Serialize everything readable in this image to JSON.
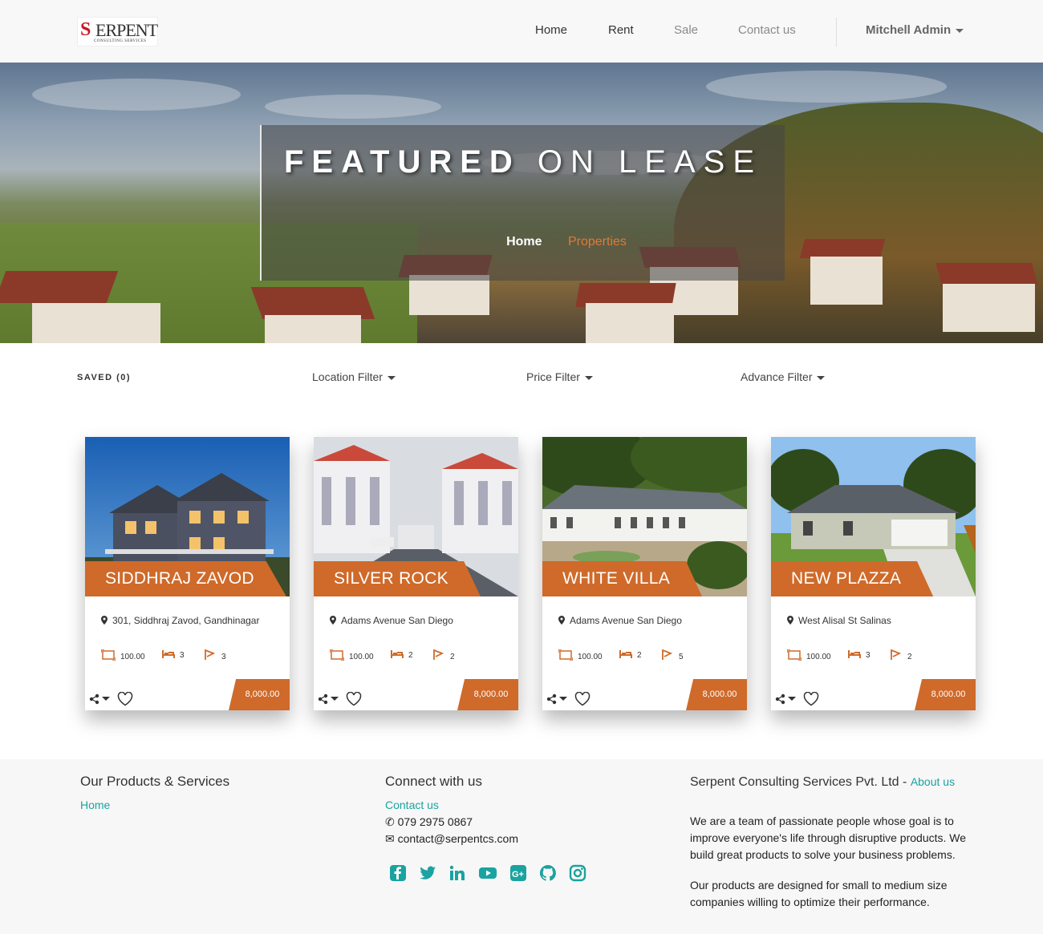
{
  "nav": {
    "logo_text": "SERPENT",
    "logo_subtext": "CONSULTING SERVICES",
    "links": [
      "Home",
      "Rent",
      "Sale",
      "Contact us"
    ],
    "user": "Mitchell Admin"
  },
  "hero": {
    "title_strong": "FEATURED",
    "title_rest": "ON LEASE",
    "breadcrumb_home": "Home",
    "breadcrumb_active": "Properties"
  },
  "filters": {
    "saved": "SAVED (0)",
    "location": "Location Filter",
    "price": "Price Filter",
    "advance": "Advance Filter"
  },
  "properties": [
    {
      "name": "SIDDHRAJ ZAVOD",
      "address": "301, Siddhraj Zavod, Gandhinagar",
      "area": "100.00",
      "beds": "3",
      "baths": "3",
      "price": "8,000.00"
    },
    {
      "name": "SILVER ROCK",
      "address": "Adams Avenue San Diego",
      "area": "100.00",
      "beds": "2",
      "baths": "2",
      "price": "8,000.00"
    },
    {
      "name": "WHITE VILLA",
      "address": "Adams Avenue San Diego",
      "area": "100.00",
      "beds": "2",
      "baths": "5",
      "price": "8,000.00"
    },
    {
      "name": "NEW PLAZZA",
      "address": "West Alisal St Salinas",
      "area": "100.00",
      "beds": "3",
      "baths": "2",
      "price": "8,000.00"
    }
  ],
  "footer": {
    "col1_title": "Our Products & Services",
    "col1_link": "Home",
    "col2_title": "Connect with us",
    "col2_link": "Contact us",
    "phone": "079 2975 0867",
    "email": "contact@serpentcs.com",
    "col3_title": "Serpent Consulting Services Pvt. Ltd -",
    "col3_link": "About us",
    "para1": "We are a team of passionate people whose goal is to improve everyone's life through disruptive products. We build great products to solve your business problems.",
    "para2": "Our products are designed for small to medium size companies willing to optimize their performance.",
    "social_icons": [
      "facebook-icon",
      "twitter-icon",
      "linkedin-icon",
      "youtube-icon",
      "google-plus-icon",
      "github-icon",
      "instagram-icon"
    ]
  },
  "colors": {
    "accent": "#cf6a2a",
    "link": "#1aa3a0"
  }
}
